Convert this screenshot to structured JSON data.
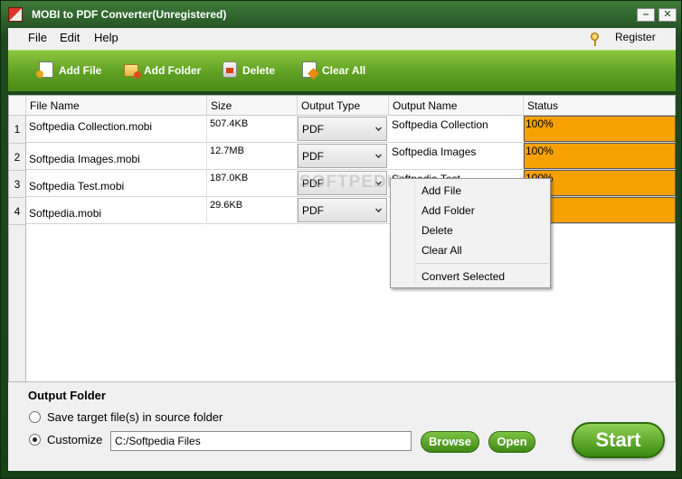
{
  "window": {
    "title": "MOBI to PDF Converter(Unregistered)"
  },
  "menu": {
    "file": "File",
    "edit": "Edit",
    "help": "Help",
    "register": "Register"
  },
  "toolbar": {
    "add_file": "Add File",
    "add_folder": "Add Folder",
    "delete": "Delete",
    "clear_all": "Clear All"
  },
  "table": {
    "columns": {
      "file_name": "File Name",
      "size": "Size",
      "output_type": "Output Type",
      "output_name": "Output Name",
      "status": "Status"
    },
    "rows": [
      {
        "index": "1",
        "file_name": "Softpedia Collection.mobi",
        "size": "507.4KB",
        "output_type": "PDF",
        "output_name": "Softpedia Collection",
        "status": "100%"
      },
      {
        "index": "2",
        "file_name": "Softpedia Images.mobi",
        "size": "12.7MB",
        "output_type": "PDF",
        "output_name": "Softpedia Images",
        "status": "100%"
      },
      {
        "index": "3",
        "file_name": "Softpedia Test.mobi",
        "size": "187.0KB",
        "output_type": "PDF",
        "output_name": "Softpedia Test",
        "status": "100%"
      },
      {
        "index": "4",
        "file_name": "Softpedia.mobi",
        "size": "29.6KB",
        "output_type": "PDF",
        "output_name": "",
        "status": ""
      }
    ]
  },
  "context_menu": {
    "add_file": "Add File",
    "add_folder": "Add Folder",
    "delete": "Delete",
    "clear_all": "Clear All",
    "convert_selected": "Convert Selected"
  },
  "watermark": "SOFTPEDIA",
  "output": {
    "title": "Output Folder",
    "option_source": "Save target file(s) in source folder",
    "option_customize": "Customize",
    "path": "C:/Softpedia Files",
    "browse": "Browse",
    "open": "Open",
    "start": "Start"
  },
  "colors": {
    "accent_green": "#5fa022",
    "status_orange": "#f7a100",
    "window_bg": "#1e4a1e"
  }
}
